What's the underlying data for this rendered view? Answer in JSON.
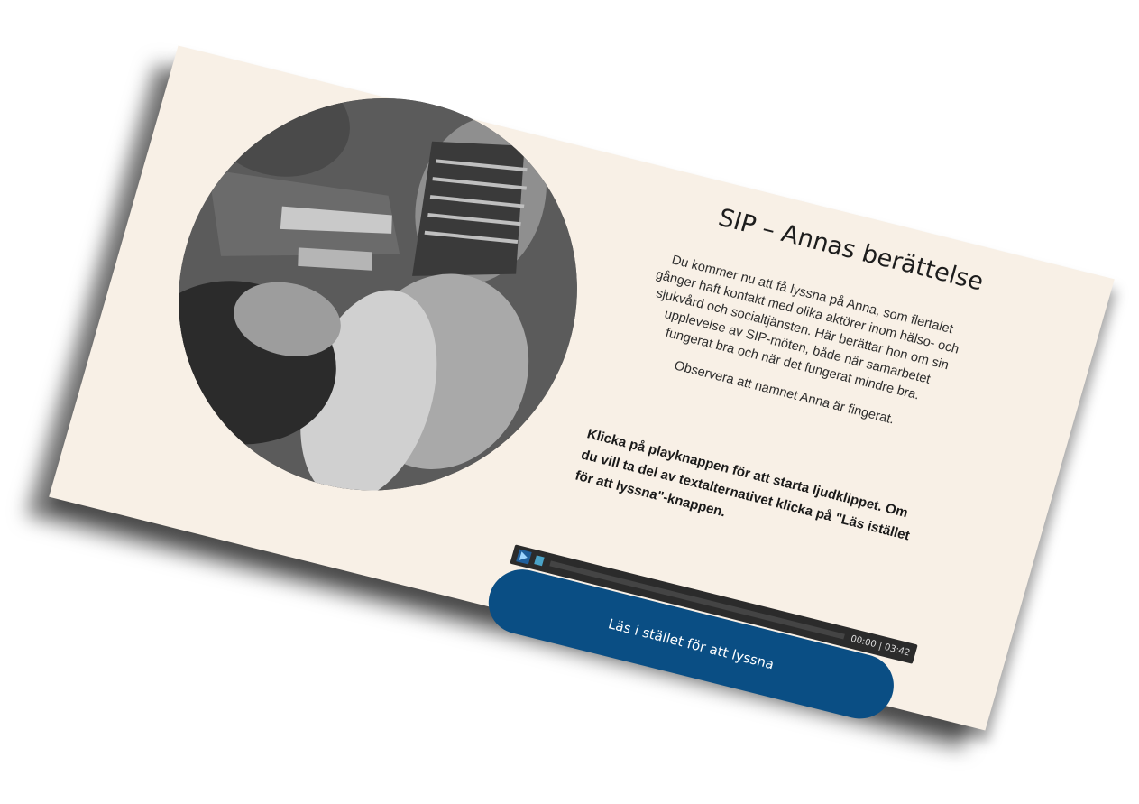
{
  "slide": {
    "title": "SIP – Annas berättelse",
    "paragraph1": "Du kommer nu att få lyssna på Anna, som flertalet gånger haft kontakt med olika aktörer inom hälso- och sjukvård och socialtjänsten. Här berättar hon om sin upplevelse av SIP-möten, både när samarbetet fungerat bra och när det fungerat mindre bra.",
    "paragraph2": "Observera att namnet Anna är fingerat.",
    "instruction": "Klicka på playknappen för att starta ljudklippet. Om du vill ta del av textalternativet klicka på \"Läs istället för att lyssna\"-knappen."
  },
  "audio_player": {
    "time": "00:00 | 03:42",
    "progress": 0
  },
  "read_button": {
    "label": "Läs i stället för att lyssna"
  },
  "colors": {
    "card_background": "#f8f0e6",
    "button_blue": "#0a4e84",
    "player_background": "#2b2b2b"
  },
  "icons": {
    "play": "play-icon",
    "stop": "stop-icon"
  }
}
